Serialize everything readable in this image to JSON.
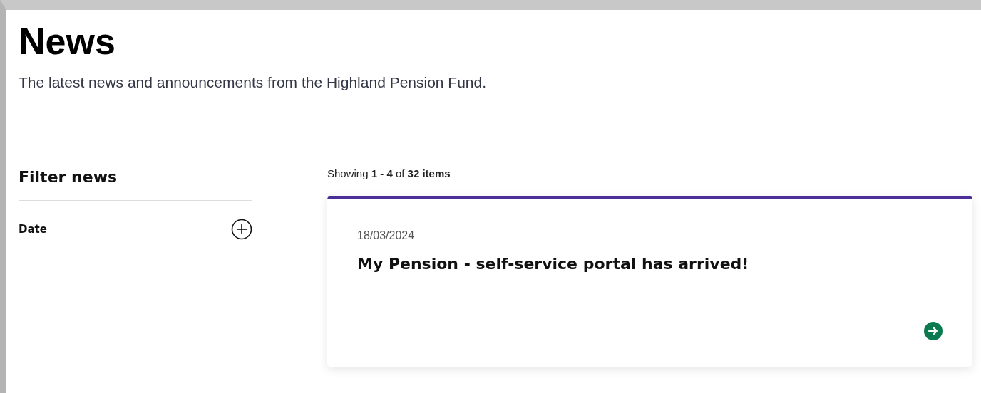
{
  "page": {
    "title": "News",
    "intro": "The latest news and announcements from the Highland Pension Fund."
  },
  "filters": {
    "title": "Filter news",
    "items": [
      {
        "label": "Date",
        "expanded": false
      }
    ]
  },
  "results": {
    "summary": "Showing **1 - 4** of **32 items**",
    "cards": [
      {
        "date": "18/03/2024",
        "title": "My Pension - self-service portal has arrived!"
      }
    ]
  }
}
